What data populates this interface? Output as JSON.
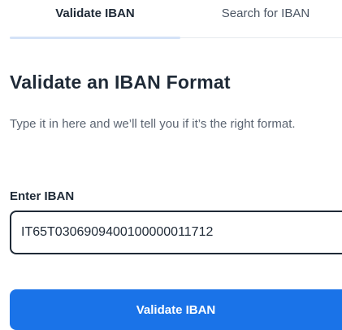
{
  "tabs": [
    {
      "label": "Validate IBAN",
      "active": true
    },
    {
      "label": "Search for IBAN",
      "active": false
    }
  ],
  "main": {
    "title": "Validate an IBAN Format",
    "description": "Type it in here and we’ll tell you if it’s the right format.",
    "field_label": "Enter IBAN",
    "iban_value": "IT65T0306909400100000011712",
    "submit_label": "Validate IBAN"
  },
  "colors": {
    "accent": "#1a73e8",
    "active_tab_underline": "#d4e2f7",
    "heading_text": "#1f2a37",
    "body_text": "#5b6471"
  }
}
